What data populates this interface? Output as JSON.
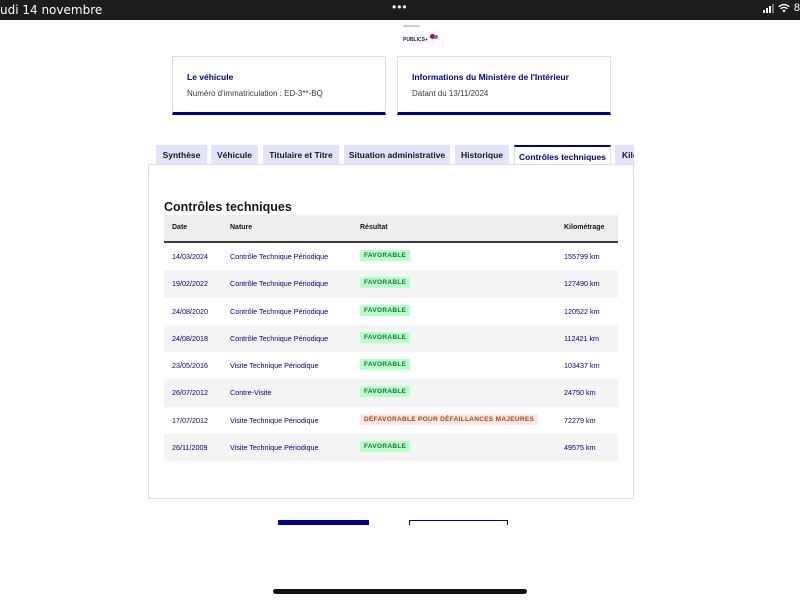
{
  "status_bar": {
    "time": "udi 14 novembre",
    "battery": "8"
  },
  "logo": {
    "top_text": "SERVICES",
    "main_text": "PUBLICS+"
  },
  "cards": [
    {
      "title": "Le véhicule",
      "subtitle": "Numéro d'immatriculation : ED-3**-BQ"
    },
    {
      "title": "Informations du Ministère de l'Intérieur",
      "subtitle": "Datant du 13/11/2024"
    }
  ],
  "tabs": [
    {
      "label": "Synthèse"
    },
    {
      "label": "Véhicule"
    },
    {
      "label": "Titulaire et Titre"
    },
    {
      "label": "Situation administrative"
    },
    {
      "label": "Historique"
    },
    {
      "label": "Contrôles techniques",
      "active": true
    },
    {
      "label": "Kilo"
    }
  ],
  "section": {
    "title": "Contrôles techniques"
  },
  "table": {
    "headers": {
      "date": "Date",
      "nature": "Nature",
      "result": "Résultat",
      "km": "Kilométrage"
    },
    "rows": [
      {
        "date": "14/03/2024",
        "nature": "Contrôle Technique Périodique",
        "result": "FAVORABLE",
        "status": "ok",
        "km": "155799 km"
      },
      {
        "date": "19/02/2022",
        "nature": "Contrôle Technique Périodique",
        "result": "FAVORABLE",
        "status": "ok",
        "km": "127490 km"
      },
      {
        "date": "24/08/2020",
        "nature": "Contrôle Technique Périodique",
        "result": "FAVORABLE",
        "status": "ok",
        "km": "120522 km"
      },
      {
        "date": "24/08/2018",
        "nature": "Contrôle Technique Périodique",
        "result": "FAVORABLE",
        "status": "ok",
        "km": "112421 km"
      },
      {
        "date": "23/05/2016",
        "nature": "Visite Technique Périodique",
        "result": "FAVORABLE",
        "status": "ok",
        "km": "103437 km"
      },
      {
        "date": "26/07/2012",
        "nature": "Contre-Visite",
        "result": "FAVORABLE",
        "status": "ok",
        "km": "24750 km"
      },
      {
        "date": "17/07/2012",
        "nature": "Visite Technique Périodique",
        "result": "DÉFAVORABLE POUR DÉFAILLANCES MAJEURES",
        "status": "ko",
        "km": "72279 km"
      },
      {
        "date": "26/11/2009",
        "nature": "Visite Technique Périodique",
        "result": "FAVORABLE",
        "status": "ok",
        "km": "49575 km"
      }
    ]
  },
  "colors": {
    "primary": "#000091",
    "success_bg": "#b8fec9",
    "success_text": "#18753c",
    "error_bg": "#ffe9e6",
    "error_text": "#b34000",
    "tab_bg": "#e3e3fd"
  }
}
